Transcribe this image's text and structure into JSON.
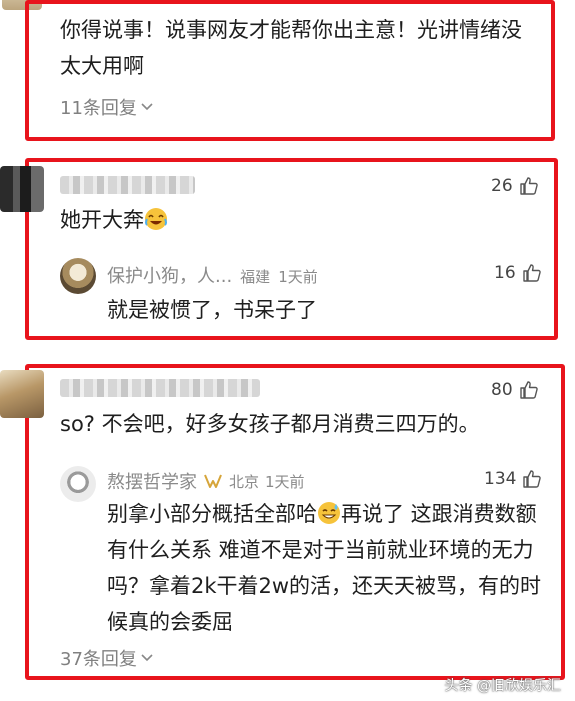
{
  "comment1": {
    "text": "你得说事！说事网友才能帮你出主意！光讲情绪没太大用啊",
    "replies_label": "11条回复"
  },
  "comment2": {
    "likes": "26",
    "text": "她开大奔",
    "reply": {
      "user": "保护小狗，人...",
      "location": "福建",
      "time": "1天前",
      "likes": "16",
      "text": "就是被惯了，书呆子了"
    }
  },
  "comment3": {
    "likes": "80",
    "text": "so? 不会吧，好多女孩子都月消费三四万的。",
    "reply": {
      "user": "熬摆哲学家",
      "location": "北京",
      "time": "1天前",
      "likes": "134",
      "text_part1": "别拿小部分概括全部哈",
      "text_part2": "再说了 这跟消费数额有什么关系 难道不是对于当前就业环境的无力吗？拿着2k干着2w的活，还天天被骂，有的时候真的会委屈"
    },
    "replies_label": "37条回复"
  },
  "watermark": "头条 @旧欣娱乐汇",
  "colors": {
    "highlight": "#e8141c",
    "meta_gray": "#8a8a8a",
    "badge_gold": "#d6a53a"
  }
}
